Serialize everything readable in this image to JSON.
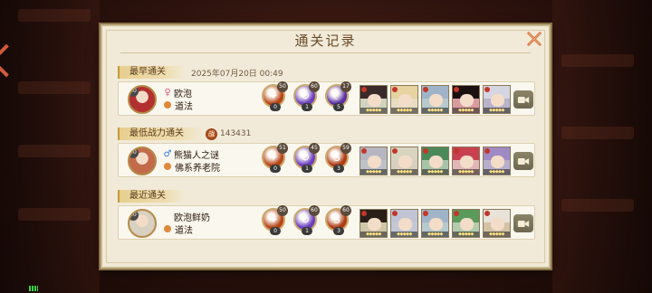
{
  "dialog": {
    "title": "通关记录",
    "close_icon": "close-icon"
  },
  "colors": {
    "panel_bg": "#f1ead8",
    "section_label_bg": "#e6cf8e",
    "title_text": "#6a4a2a",
    "skill_fire": "#b84416",
    "skill_purple": "#6a3fc0",
    "replay_button": "#7c7458"
  },
  "sections": [
    {
      "label": "最早通关",
      "extra": "2025年07月20日  00:49",
      "player": {
        "level": "60",
        "gender": "♀",
        "name": "欧泡",
        "guild": "道法",
        "avatar_tint": "#b23030"
      },
      "skills": [
        {
          "top": "50",
          "bottom": "0",
          "icon": "fire-skill-icon",
          "color": "#b84416",
          "glyph": "✦"
        },
        {
          "top": "60",
          "bottom": "1",
          "icon": "wind-skill-icon",
          "color": "#6a3fc0",
          "glyph": "↻"
        },
        {
          "top": "17",
          "bottom": "5",
          "icon": "moon-skill-icon",
          "color": "#5a2fa8",
          "glyph": "☾"
        }
      ],
      "cards": [
        {
          "hair": "#3a2a2a",
          "bg": "#cfd3c0",
          "stars": "◆◆◆◆◆"
        },
        {
          "hair": "#e6d3a0",
          "bg": "#e8ddc4",
          "stars": "◆◆◆◆◆"
        },
        {
          "hair": "#9fb4c8",
          "bg": "#b6c9cc",
          "stars": "◆◆◆◆◆"
        },
        {
          "hair": "#1a1010",
          "bg": "#d99aa0",
          "stars": "◆◆◆◆◆"
        },
        {
          "hair": "#d6d6e2",
          "bg": "#b8b3cc",
          "stars": "◆◆◆◆◆"
        }
      ],
      "replay_icon": "camera-replay-icon"
    },
    {
      "label": "最低战力通关",
      "extra": "143431",
      "power_icon": "战",
      "player": {
        "level": "60",
        "gender": "♂",
        "name": "熊猫人之谜",
        "guild": "佛系养老院",
        "avatar_tint": "#c26a4a"
      },
      "skills": [
        {
          "top": "51",
          "bottom": "0",
          "icon": "fire-skill-icon",
          "color": "#b84416",
          "glyph": "✦"
        },
        {
          "top": "45",
          "bottom": "1",
          "icon": "wind-skill-icon",
          "color": "#6a3fc0",
          "glyph": "↻"
        },
        {
          "top": "59",
          "bottom": "3",
          "icon": "snake-skill-icon",
          "color": "#b03a14",
          "glyph": "S"
        }
      ],
      "cards": [
        {
          "hair": "#b6b6c2",
          "bg": "#bcc2c8",
          "stars": "◆◆◆◆◆"
        },
        {
          "hair": "#d8d4c0",
          "bg": "#d8cfbe",
          "stars": "◆◆◆◆◆"
        },
        {
          "hair": "#4a8a5a",
          "bg": "#a8c4a8",
          "stars": "◆◆◆◆◆"
        },
        {
          "hair": "#c84050",
          "bg": "#e2b6b6",
          "stars": "◆◆◆◆◆"
        },
        {
          "hair": "#a08ac4",
          "bg": "#b8aecc",
          "stars": "◆◆◆◆◆"
        }
      ],
      "replay_icon": "camera-replay-icon"
    },
    {
      "label": "最近通关",
      "extra": "",
      "player": {
        "level": "60",
        "gender": "",
        "name": "欧泡鲜奶",
        "guild": "道法",
        "avatar_tint": "#d8d0c0"
      },
      "skills": [
        {
          "top": "50",
          "bottom": "0",
          "icon": "fire-skill-icon",
          "color": "#b84416",
          "glyph": "✦"
        },
        {
          "top": "60",
          "bottom": "1",
          "icon": "wind-skill-icon",
          "color": "#6a3fc0",
          "glyph": "↻"
        },
        {
          "top": "60",
          "bottom": "3",
          "icon": "snake-skill-icon",
          "color": "#b03a14",
          "glyph": "S"
        }
      ],
      "cards": [
        {
          "hair": "#2a1f18",
          "bg": "#d0c6a8",
          "stars": "◆◆◆◆◆"
        },
        {
          "hair": "#c0c4d4",
          "bg": "#c4c8d6",
          "stars": "◆◆◆◆◆"
        },
        {
          "hair": "#9fb4c8",
          "bg": "#b6c9cc",
          "stars": "◆◆◆◆◆"
        },
        {
          "hair": "#5a9a5a",
          "bg": "#b4ccae",
          "stars": "◆◆◆◆◆"
        },
        {
          "hair": "#e8e2d8",
          "bg": "#d4c2a6",
          "stars": "◆◆◆◆◆"
        }
      ],
      "replay_icon": "camera-replay-icon"
    }
  ]
}
